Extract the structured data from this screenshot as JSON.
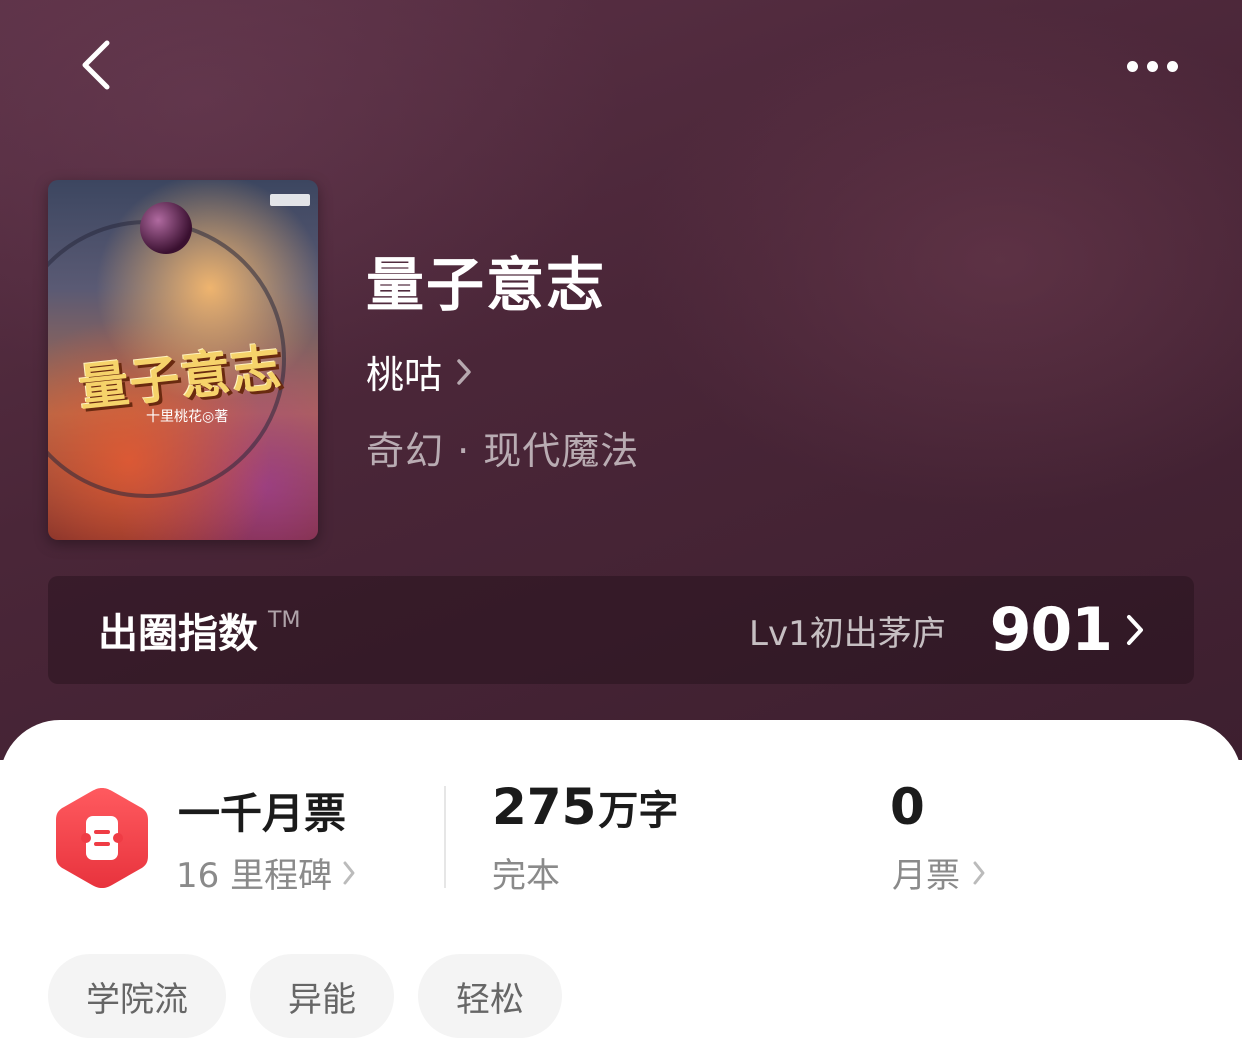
{
  "header": {
    "back_icon": "chevron-left-icon",
    "more_icon": "more-dots-icon"
  },
  "book": {
    "cover_title": "量子意志",
    "cover_author": "十里桃花◎著",
    "title": "量子意志",
    "author": "桃咕",
    "genre": "奇幻 · 现代魔法"
  },
  "index_bar": {
    "label": "出圈指数",
    "trademark": "TM",
    "level": "Lv1初出茅庐",
    "score": "901"
  },
  "stats": {
    "milestone_title": "一千月票",
    "milestone_sub": "16 里程碑",
    "word_count": "275",
    "word_unit": "万字",
    "status": "完本",
    "monthly_votes": "0",
    "monthly_label": "月票"
  },
  "tags": [
    "学院流",
    "异能",
    "轻松"
  ],
  "colors": {
    "hero_bg": "#4a2638",
    "badge_red": "#f2424d",
    "tag_bg": "#f4f4f4"
  }
}
